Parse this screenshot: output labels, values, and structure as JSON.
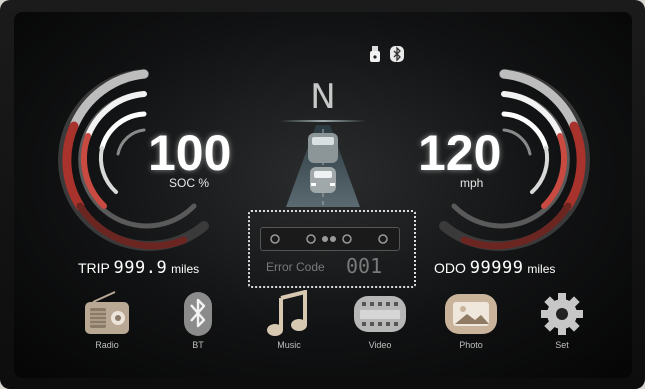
{
  "gear": "N",
  "soc": {
    "value": "100",
    "unit": "SOC %"
  },
  "speed": {
    "value": "120",
    "unit": "mph"
  },
  "trip": {
    "label": "TRIP",
    "value": "999.9",
    "unit": "miles"
  },
  "odo": {
    "label": "ODO",
    "value": "99999",
    "unit": "miles"
  },
  "error": {
    "label": "Error Code",
    "value": "001"
  },
  "status_icons": [
    "usb-icon",
    "bluetooth-icon"
  ],
  "dock": [
    {
      "label": "Radio",
      "icon": "radio-icon"
    },
    {
      "label": "BT",
      "icon": "bluetooth-icon"
    },
    {
      "label": "Music",
      "icon": "music-note-icon"
    },
    {
      "label": "Video",
      "icon": "video-film-icon"
    },
    {
      "label": "Photo",
      "icon": "photo-icon"
    },
    {
      "label": "Set",
      "icon": "gear-icon"
    }
  ],
  "colors": {
    "gauge_red": "#a8322c",
    "gauge_white": "#f2f2f2",
    "text": "#ffffff"
  }
}
